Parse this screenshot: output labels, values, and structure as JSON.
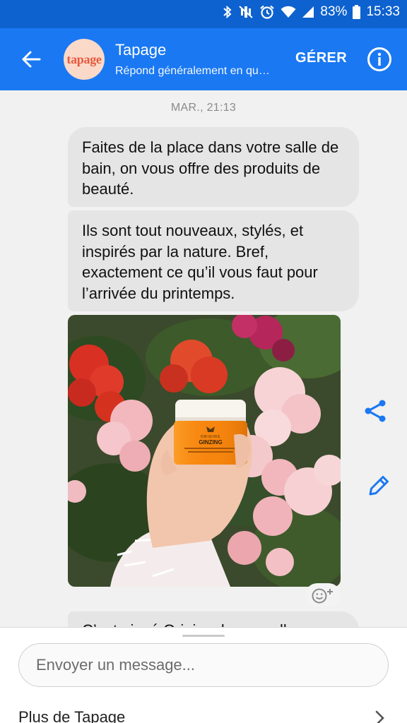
{
  "status_bar": {
    "battery": "83%",
    "time": "15:33",
    "icons": [
      "bluetooth-icon",
      "mute-icon",
      "alarm-icon",
      "wifi-icon",
      "signal-icon",
      "battery-icon"
    ]
  },
  "header": {
    "avatar_text": "tapage",
    "title": "Tapage",
    "subtitle": "Répond généralement en quelques heures",
    "manage_label": "GÉRER",
    "colors": {
      "bar": "#1a78f2",
      "status": "#0d62cf"
    }
  },
  "conversation": {
    "timestamp": "MAR., 21:13",
    "messages": [
      {
        "text": "Faites de la place dans votre salle de bain, on vous offre des produits de beauté."
      },
      {
        "text": "Ils sont tout nouveaux, stylés, et inspirés par la nature. Bref, exactement ce qu’il vous faut pour l’arrivée du printemps."
      },
      {
        "text": "C’est ainsé Origins, la nouvelle"
      }
    ],
    "photo": {
      "product_brand": "ORIGINS",
      "product_name": "GINZING"
    }
  },
  "composer": {
    "placeholder": "Envoyer un message...",
    "more_label": "Plus de Tapage"
  },
  "accent_color": "#1a78f2"
}
